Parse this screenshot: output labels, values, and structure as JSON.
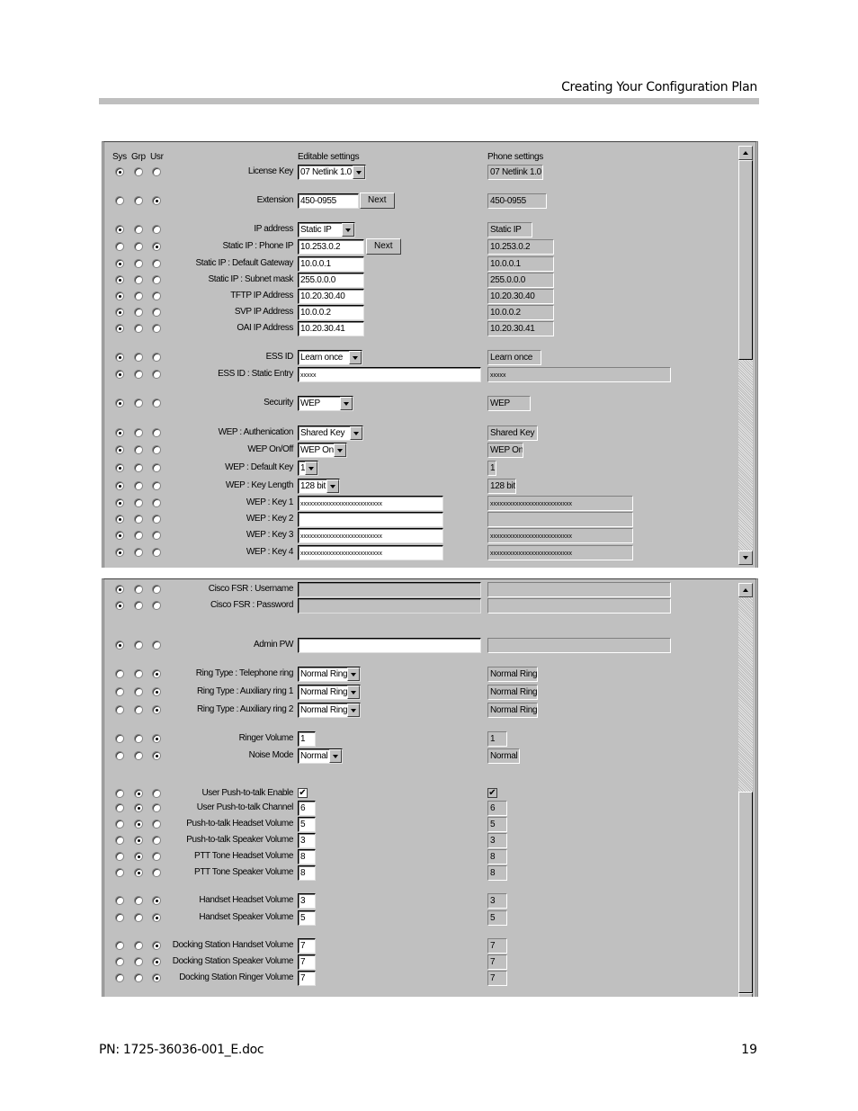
{
  "document": {
    "header": "Creating Your Configuration Plan",
    "footer_left": "PN: 1725-36036-001_E.doc",
    "page_number": "19"
  },
  "columns": {
    "sys": "Sys",
    "grp": "Grp",
    "usr": "Usr",
    "editable": "Editable settings",
    "phone": "Phone settings"
  },
  "panel1": {
    "rows": [
      {
        "label": "License Key",
        "level": "sys",
        "type": "select",
        "value": "07 Netlink 1.0",
        "phone": "07 Netlink 1.0"
      },
      {
        "label": "Extension",
        "level": "usr",
        "type": "text",
        "value": "450-0955",
        "button": "Next",
        "phone": "450-0955"
      },
      {
        "label": "IP address",
        "level": "sys",
        "type": "select",
        "value": "Static IP",
        "phone": "Static IP"
      },
      {
        "label": "Static IP : Phone IP",
        "level": "usr",
        "type": "text",
        "value": "10.253.0.2",
        "button": "Next",
        "phone": "10.253.0.2"
      },
      {
        "label": "Static IP : Default Gateway",
        "level": "sys",
        "type": "text",
        "value": "10.0.0.1",
        "phone": "10.0.0.1"
      },
      {
        "label": "Static IP : Subnet mask",
        "level": "sys",
        "type": "text",
        "value": "255.0.0.0",
        "phone": "255.0.0.0"
      },
      {
        "label": "TFTP IP Address",
        "level": "sys",
        "type": "text",
        "value": "10.20.30.40",
        "phone": "10.20.30.40"
      },
      {
        "label": "SVP IP Address",
        "level": "sys",
        "type": "text",
        "value": "10.0.0.2",
        "phone": "10.0.0.2"
      },
      {
        "label": "OAI IP Address",
        "level": "sys",
        "type": "text",
        "value": "10.20.30.41",
        "phone": "10.20.30.41"
      },
      {
        "label": "ESS ID",
        "level": "sys",
        "type": "select",
        "value": "Learn once",
        "phone": "Learn once"
      },
      {
        "label": "ESS ID : Static Entry",
        "level": "sys",
        "type": "text",
        "value": "xxxxx",
        "phone": "xxxxx"
      },
      {
        "label": "Security",
        "level": "sys",
        "type": "select",
        "value": "WEP",
        "phone": "WEP"
      },
      {
        "label": "WEP : Authenication",
        "level": "sys",
        "type": "select",
        "value": "Shared Key",
        "phone": "Shared Key"
      },
      {
        "label": "WEP On/Off",
        "level": "sys",
        "type": "select",
        "value": "WEP On",
        "phone": "WEP On"
      },
      {
        "label": "WEP : Default Key",
        "level": "sys",
        "type": "select",
        "value": "1",
        "phone": "1"
      },
      {
        "label": "WEP : Key Length",
        "level": "sys",
        "type": "select",
        "value": "128 bit",
        "phone": "128 bit"
      },
      {
        "label": "WEP : Key 1",
        "level": "sys",
        "type": "text",
        "value": "xxxxxxxxxxxxxxxxxxxxxxxxxx",
        "phone": "xxxxxxxxxxxxxxxxxxxxxxxxxx"
      },
      {
        "label": "WEP : Key 2",
        "level": "sys",
        "type": "text",
        "value": "",
        "phone": ""
      },
      {
        "label": "WEP : Key 3",
        "level": "sys",
        "type": "text",
        "value": "xxxxxxxxxxxxxxxxxxxxxxxxxx",
        "phone": "xxxxxxxxxxxxxxxxxxxxxxxxxx"
      },
      {
        "label": "WEP : Key 4",
        "level": "sys",
        "type": "text",
        "value": "xxxxxxxxxxxxxxxxxxxxxxxxxx",
        "phone": "xxxxxxxxxxxxxxxxxxxxxxxxxx"
      }
    ]
  },
  "panel2": {
    "rows": [
      {
        "label": "Cisco FSR : Username",
        "level": "sys",
        "type": "text",
        "value": "",
        "disabled": true,
        "phone": ""
      },
      {
        "label": "Cisco FSR : Password",
        "level": "sys",
        "type": "text",
        "value": "",
        "disabled": true,
        "phone": ""
      },
      {
        "label": "Admin PW",
        "level": "sys",
        "type": "text",
        "value": "",
        "phone": ""
      },
      {
        "label": "Ring Type : Telephone ring",
        "level": "usr",
        "type": "select",
        "value": "Normal Ring",
        "phone": "Normal Ring"
      },
      {
        "label": "Ring Type : Auxiliary ring 1",
        "level": "usr",
        "type": "select",
        "value": "Normal Ring",
        "phone": "Normal Ring"
      },
      {
        "label": "Ring Type : Auxiliary ring 2",
        "level": "usr",
        "type": "select",
        "value": "Normal Ring",
        "phone": "Normal Ring"
      },
      {
        "label": "Ringer Volume",
        "level": "usr",
        "type": "text",
        "value": "1",
        "phone": "1"
      },
      {
        "label": "Noise Mode",
        "level": "usr",
        "type": "select",
        "value": "Normal",
        "phone": "Normal"
      },
      {
        "label": "User Push-to-talk Enable",
        "level": "grp",
        "type": "checkbox",
        "checked": true,
        "phone_checked": true
      },
      {
        "label": "User Push-to-talk Channel",
        "level": "grp",
        "type": "text",
        "value": "6",
        "phone": "6"
      },
      {
        "label": "Push-to-talk Headset Volume",
        "level": "grp",
        "type": "text",
        "value": "5",
        "phone": "5"
      },
      {
        "label": "Push-to-talk Speaker Volume",
        "level": "grp",
        "type": "text",
        "value": "3",
        "phone": "3"
      },
      {
        "label": "PTT Tone Headset Volume",
        "level": "grp",
        "type": "text",
        "value": "8",
        "phone": "8"
      },
      {
        "label": "PTT Tone Speaker Volume",
        "level": "grp",
        "type": "text",
        "value": "8",
        "phone": "8"
      },
      {
        "label": "Handset Headset Volume",
        "level": "usr",
        "type": "text",
        "value": "3",
        "phone": "3"
      },
      {
        "label": "Handset Speaker Volume",
        "level": "usr",
        "type": "text",
        "value": "5",
        "phone": "5"
      },
      {
        "label": "Docking Station Handset Volume",
        "level": "usr",
        "type": "text",
        "value": "7",
        "phone": "7"
      },
      {
        "label": "Docking Station Speaker Volume",
        "level": "usr",
        "type": "text",
        "value": "7",
        "phone": "7"
      },
      {
        "label": "Docking Station Ringer Volume",
        "level": "usr",
        "type": "text",
        "value": "7",
        "phone": "7"
      }
    ]
  }
}
